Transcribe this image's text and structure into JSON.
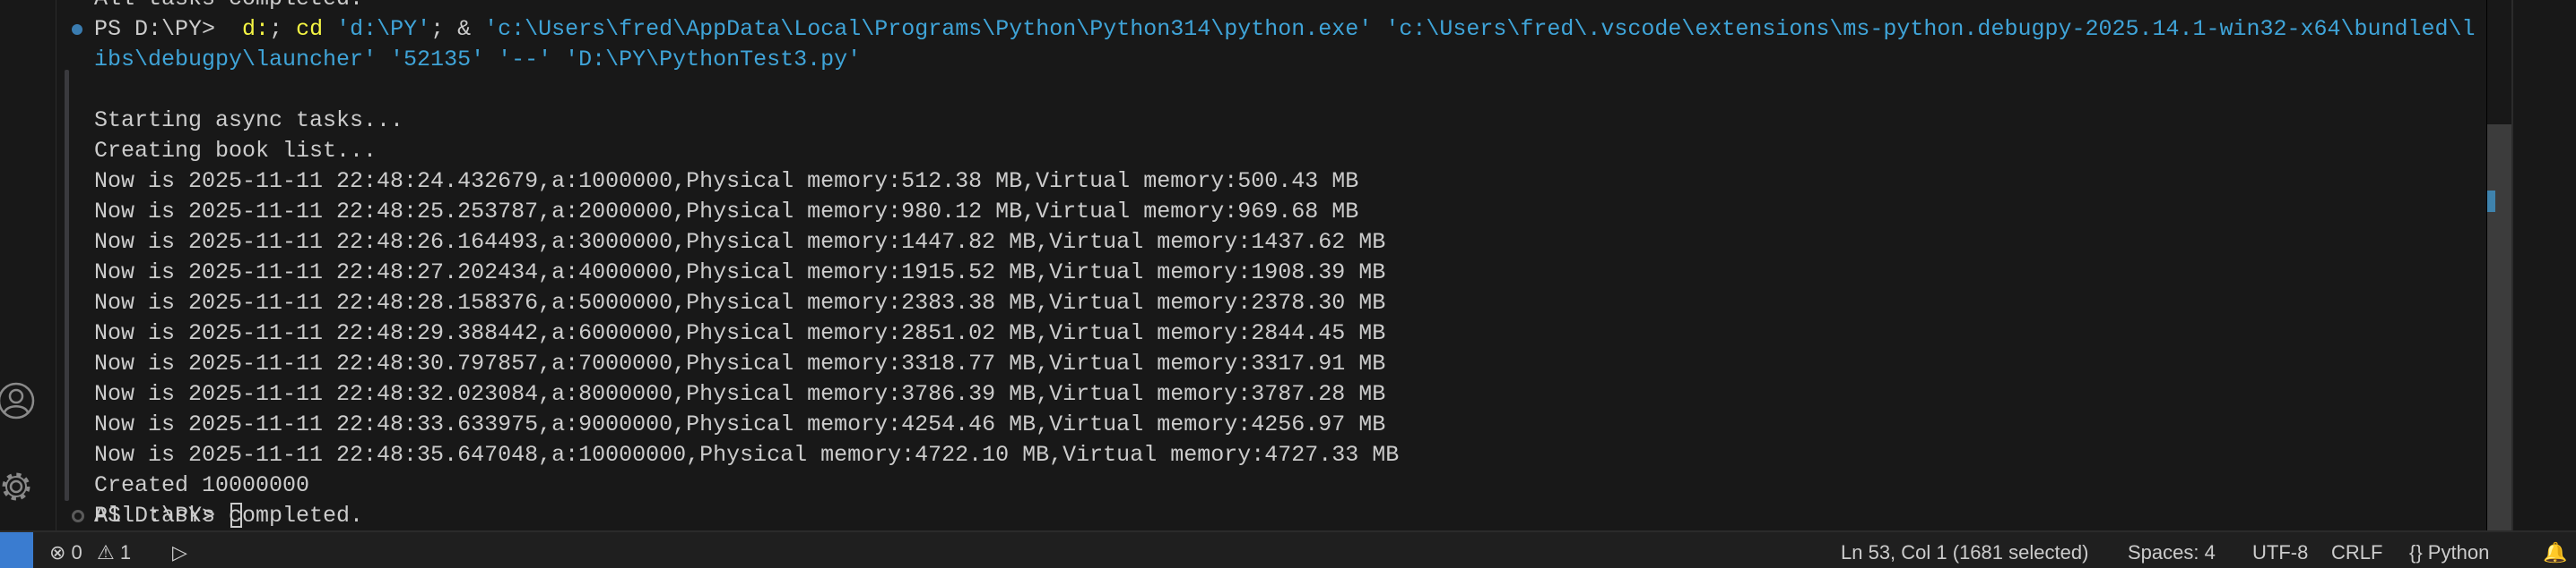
{
  "terminal": {
    "previous_line": "All tasks completed.",
    "command_line1": [
      {
        "text": "PS D:\\PY>  ",
        "cls": ""
      },
      {
        "text": "d:",
        "cls": "y"
      },
      {
        "text": "; ",
        "cls": ""
      },
      {
        "text": "cd",
        "cls": "y"
      },
      {
        "text": " ",
        "cls": ""
      },
      {
        "text": "'d:\\PY'",
        "cls": "c"
      },
      {
        "text": "; & ",
        "cls": ""
      },
      {
        "text": "'c:\\Users\\fred\\AppData\\Local\\Programs\\Python\\Python314\\python.exe'",
        "cls": "c"
      },
      {
        "text": " ",
        "cls": ""
      },
      {
        "text": "'c:\\Users\\fred\\.vscode\\extensions\\ms-python.debugpy-2025.14.1-win32-x64\\bundled\\l",
        "cls": "c"
      }
    ],
    "command_line2": "ibs\\debugpy\\launcher' '52135' '--' 'D:\\PY\\PythonTest3.py'",
    "output": [
      "Starting async tasks...",
      "Creating book list...",
      "Now is 2025-11-11 22:48:24.432679,a:1000000,Physical memory:512.38 MB,Virtual memory:500.43 MB",
      "Now is 2025-11-11 22:48:25.253787,a:2000000,Physical memory:980.12 MB,Virtual memory:969.68 MB",
      "Now is 2025-11-11 22:48:26.164493,a:3000000,Physical memory:1447.82 MB,Virtual memory:1437.62 MB",
      "Now is 2025-11-11 22:48:27.202434,a:4000000,Physical memory:1915.52 MB,Virtual memory:1908.39 MB",
      "Now is 2025-11-11 22:48:28.158376,a:5000000,Physical memory:2383.38 MB,Virtual memory:2378.30 MB",
      "Now is 2025-11-11 22:48:29.388442,a:6000000,Physical memory:2851.02 MB,Virtual memory:2844.45 MB",
      "Now is 2025-11-11 22:48:30.797857,a:7000000,Physical memory:3318.77 MB,Virtual memory:3317.91 MB",
      "Now is 2025-11-11 22:48:32.023084,a:8000000,Physical memory:3786.39 MB,Virtual memory:3787.28 MB",
      "Now is 2025-11-11 22:48:33.633975,a:9000000,Physical memory:4254.46 MB,Virtual memory:4256.97 MB",
      "Now is 2025-11-11 22:48:35.647048,a:10000000,Physical memory:4722.10 MB,Virtual memory:4727.33 MB",
      "Created 10000000",
      "All tasks completed."
    ],
    "prompt": "PS D:\\PY> "
  },
  "statusbar": {
    "errors": "0",
    "warnings": "1",
    "position": "Ln 53, Col 1 (1681 selected)",
    "spaces": "Spaces: 4",
    "encoding": "UTF-8",
    "eol": "CRLF",
    "language": "{} Python"
  },
  "colors": {
    "accent": "#3a7cd0",
    "yellow": "#f5f543",
    "string": "#3fa4d8",
    "text": "#cccccc",
    "background": "#181818"
  }
}
